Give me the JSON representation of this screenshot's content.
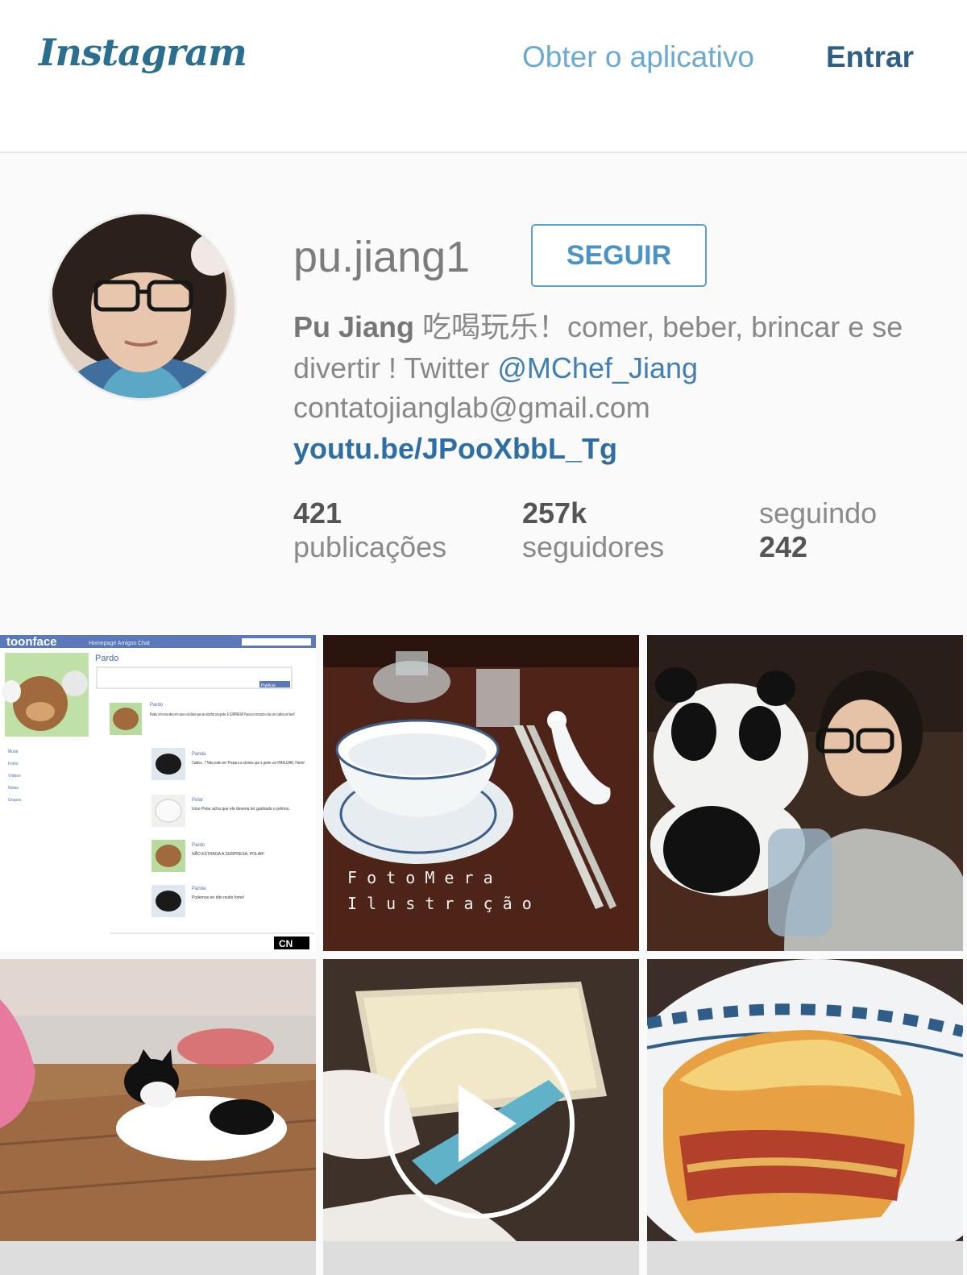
{
  "header": {
    "logo": "Instagram",
    "get_app": "Obter o aplicativo",
    "login": "Entrar"
  },
  "profile": {
    "username": "pu.jiang1",
    "follow_button": "SEGUIR",
    "bio": {
      "name": "Pu Jiang",
      "text": "吃喝玩乐！comer, beber, brincar e se divertir ! Twitter ",
      "mention": "@MChef_Jiang",
      "email": "contatojianglab@gmail.com",
      "link": "youtu.be/JPooXbbL_Tg"
    },
    "stats": {
      "posts": {
        "value": "421",
        "label": "publicações"
      },
      "followers": {
        "value": "257k",
        "label": "seguidores"
      },
      "following": {
        "value": "242",
        "label": "seguindo"
      }
    }
  },
  "posts": [
    {
      "alt": "toonface screenshot",
      "brand": "toonface",
      "nav": "Homepage   Amigos   Chat",
      "profile_name": "Pardo",
      "search_btn": "Publicar",
      "sidebar": [
        "Mural",
        "Fotos",
        "Vídeos",
        "Notas",
        "Grupos"
      ],
      "feed": [
        {
          "name": "Pardo",
          "text": "Panda, tem uma ideia em casa e ela disse que vai cozinhar pra gente. É SURPRESA! Passa no mercado e traz uns caldos por favor!"
        },
        {
          "name": "Panda",
          "text": "Caldos...? Não pode ser! Prepara a câmera que a gente vai VIRALIZAR, Pardo!"
        },
        {
          "name": "Polar",
          "text": "Urso Polar acha que ele deveria ter ganhado o prêmio."
        },
        {
          "name": "Pardo",
          "text": "NÃO ESTRAGA A SURPRESA, POLAR!"
        },
        {
          "name": "Panda",
          "text": "Podemos ter dito muito fome!"
        }
      ],
      "logo": "CN"
    },
    {
      "alt": "tea bowl and chopsticks",
      "caption_line1": "F o t o   M e r a",
      "caption_line2": "I l u s t r a ç ã o"
    },
    {
      "alt": "woman with panda plush"
    },
    {
      "alt": "cat under table"
    },
    {
      "alt": "lasagna video"
    },
    {
      "alt": "lasagna on plate"
    }
  ]
}
